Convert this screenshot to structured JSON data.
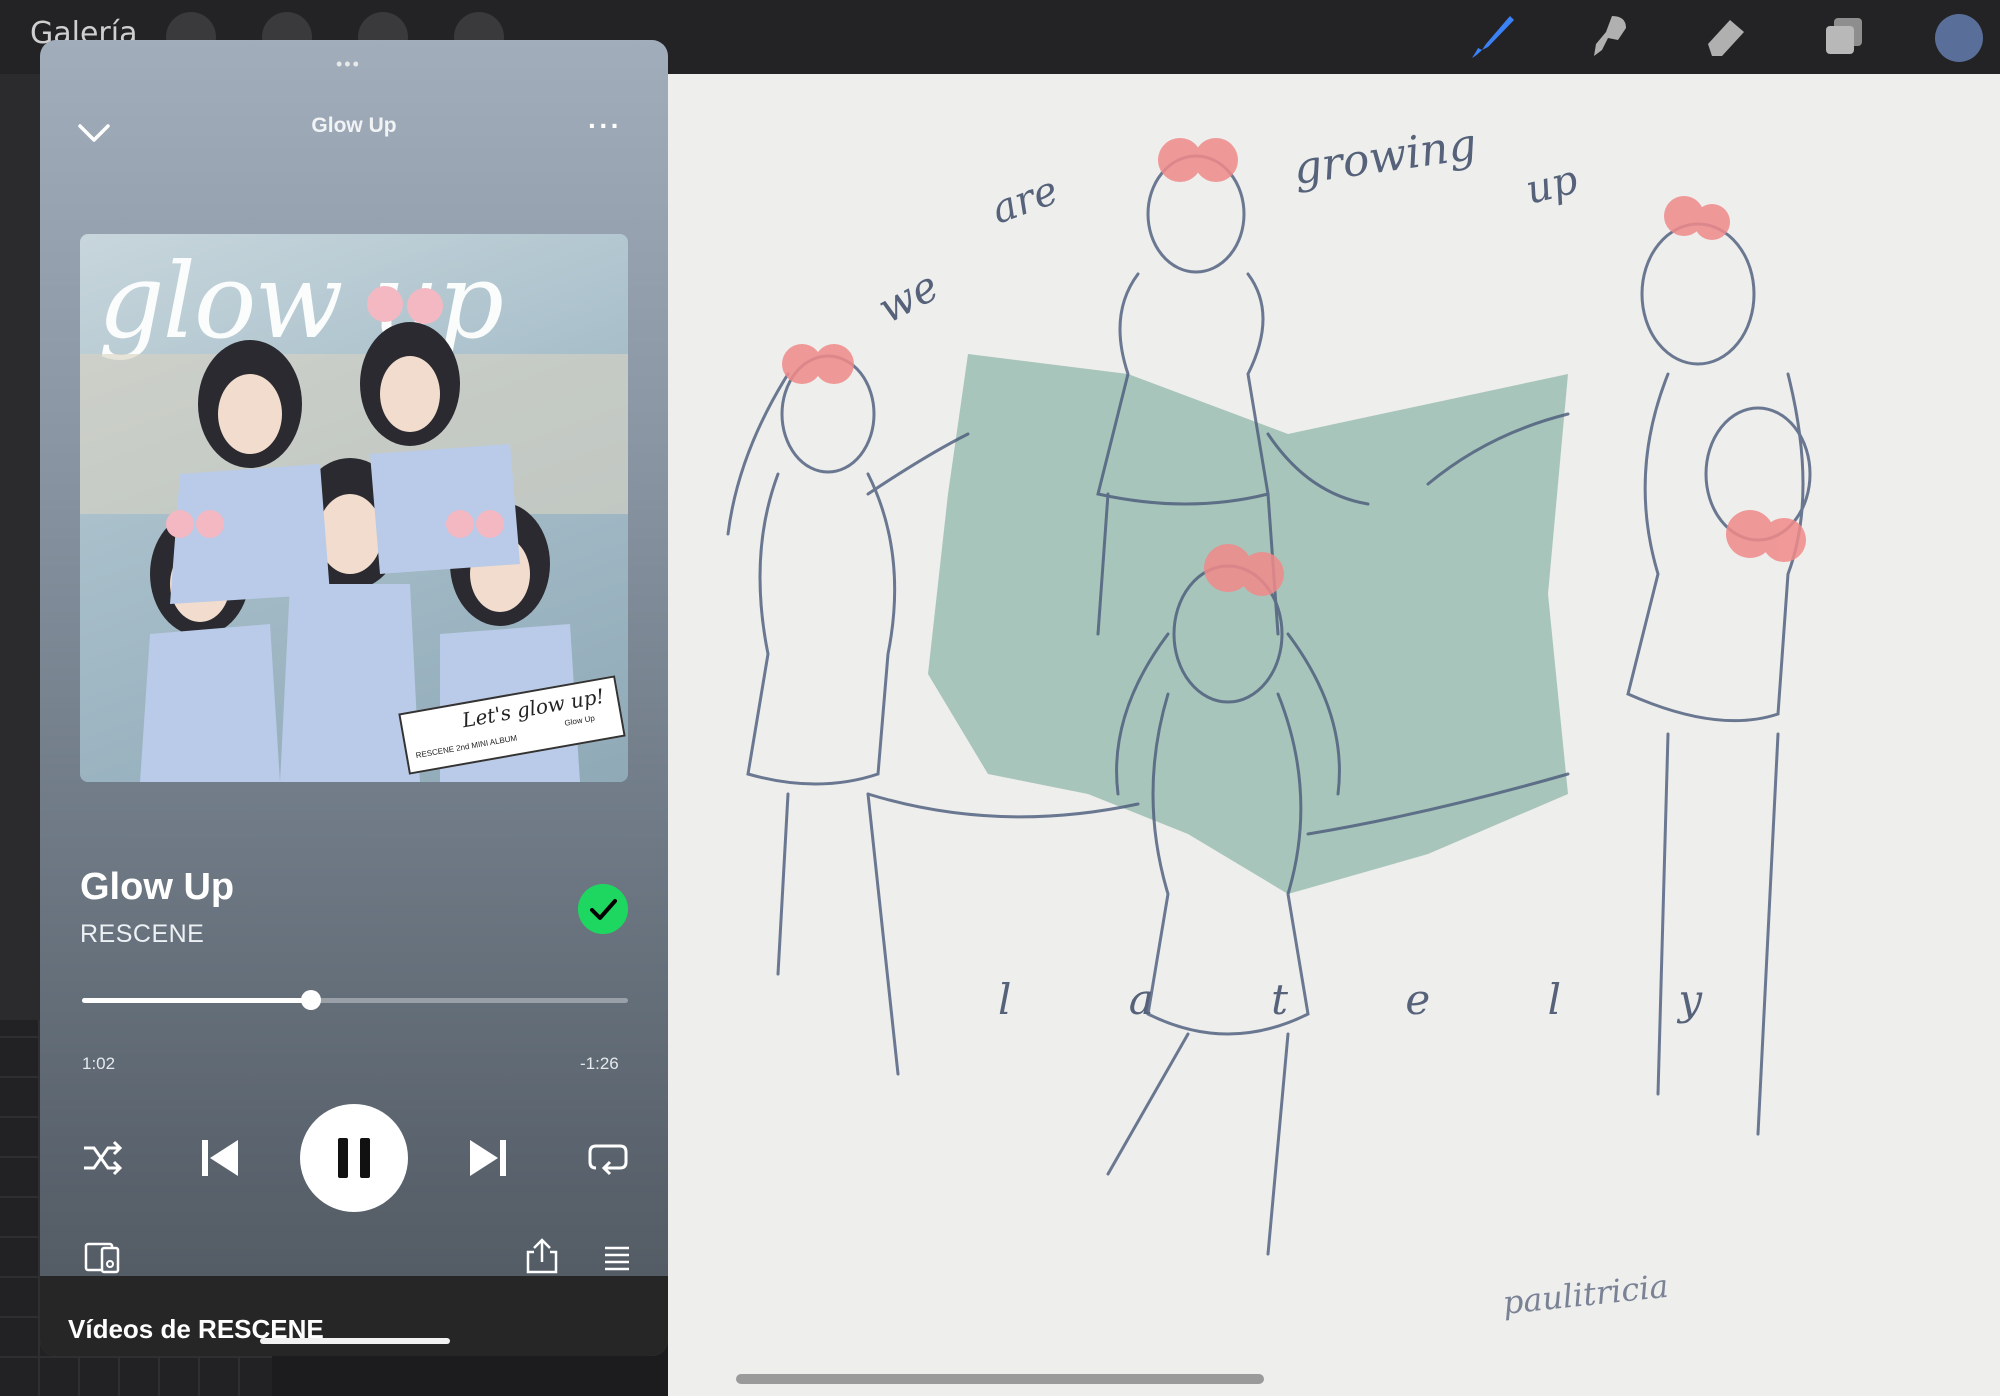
{
  "app": {
    "gallery_label": "Galería",
    "signature": "paulitricia",
    "lettering": {
      "line1": "we are growing up",
      "line2": "l a t e l y"
    }
  },
  "player": {
    "header_title": "Glow Up",
    "album_logo": "glow up",
    "sticker_handwriting": "Let's glow up!",
    "sticker_small_left": "RESCENE 2nd MINI ALBUM",
    "sticker_small_right": "Glow Up",
    "song_title": "Glow Up",
    "artist": "RESCENE",
    "elapsed": "1:02",
    "remaining": "-1:26",
    "progress": 0.42,
    "videos_section": "Vídeos de RESCENE"
  },
  "colors": {
    "accent_green": "#1ed760",
    "canvas_bg": "#eeeeec",
    "teal_fill": "#9bbdb3",
    "pink_bows": "#f08a8a"
  },
  "icons": [
    "chevron-down-icon",
    "more-icon",
    "check-icon",
    "shuffle-icon",
    "previous-icon",
    "pause-icon",
    "next-icon",
    "repeat-icon",
    "devices-icon",
    "share-icon",
    "queue-icon",
    "brush-icon",
    "smudge-icon",
    "eraser-icon",
    "layers-icon",
    "wrench-icon",
    "magic-wand-icon",
    "selection-icon",
    "transform-icon"
  ]
}
